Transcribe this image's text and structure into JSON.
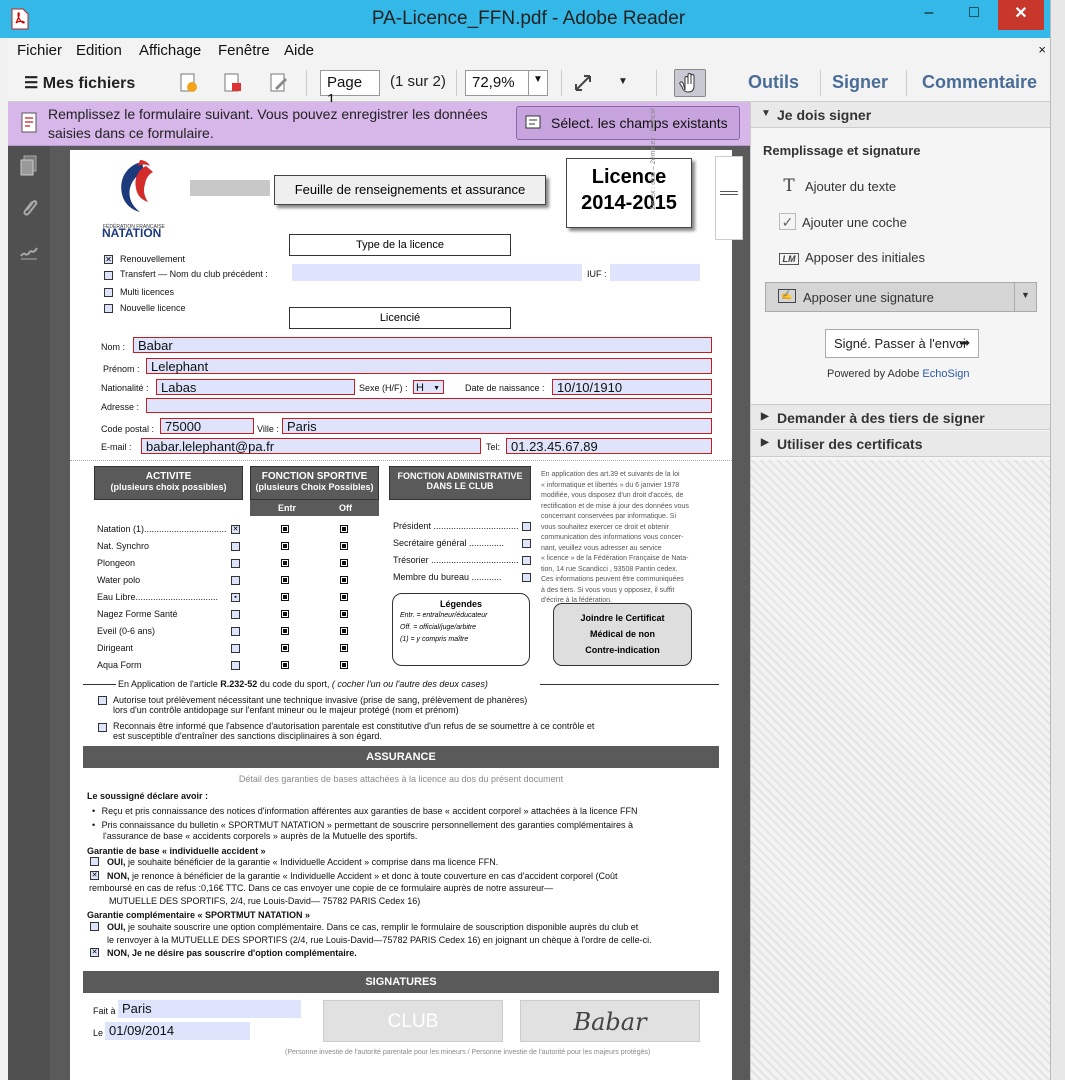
{
  "window": {
    "title": "PA-Licence_FFN.pdf - Adobe Reader",
    "minimize": "–",
    "maximize": "□",
    "close": "✕"
  },
  "menu": {
    "items": [
      "Fichier",
      "Edition",
      "Affichage",
      "Fenêtre",
      "Aide"
    ],
    "close": "×"
  },
  "toolbar": {
    "my_files": "Mes fichiers",
    "page_value": "Page 1",
    "page_of": "(1 sur 2)",
    "zoom": "72,9%",
    "tools": "Outils",
    "sign": "Signer",
    "comment": "Commentaire"
  },
  "notice": {
    "text": "Remplissez le formulaire suivant. Vous pouvez enregistrer les données saisies dans ce formulaire.",
    "button": "Sélect. les champs existants"
  },
  "panel": {
    "section1": "Je dois signer",
    "subheading": "Remplissage et signature",
    "add_text": "Ajouter du texte",
    "add_check": "Ajouter une coche",
    "add_initials": "Apposer des initiales",
    "add_signature": "Apposer une signature",
    "signed_send": "Signé. Passer à l'envoi",
    "powered": "Powered by Adobe",
    "echosign": "EchoSign",
    "section2": "Demander à des tiers de signer",
    "section3": "Utiliser des certificats"
  },
  "doc": {
    "logo_small": "FÉDÉRATION FRANÇAISE",
    "logo_name": "NATATION",
    "header_banner": "Feuille de renseignements et assurance",
    "licence_title": "Licence",
    "licence_year": "2014-2015",
    "side_note": "1er ex : club – 2ème ex : licencié",
    "type_section": "Type de la licence",
    "renouvellement": "Renouvellement",
    "transfert": "Transfert — Nom du club précédent :",
    "iuf": "IUF :",
    "multi": "Multi licences",
    "nouvelle": "Nouvelle licence",
    "licencie_section": "Licencié",
    "nom_label": "Nom :",
    "nom": "Babar",
    "prenom_label": "Prénom :",
    "prenom": "Lelephant",
    "nationalite_label": "Nationalité :",
    "nationalite": "Labas",
    "sexe_label": "Sexe (H/F) :",
    "sexe": "H",
    "naissance_label": "Date de naissance :",
    "naissance": "10/10/1910",
    "adresse_label": "Adresse :",
    "cp_label": "Code postal :",
    "cp": "75000",
    "ville_label": "Ville :",
    "ville": "Paris",
    "email_label": "E-mail :",
    "email": "babar.lelephant@pa.fr",
    "tel_label": "Tel:",
    "tel": "01.23.45.67.89",
    "activite_title": "ACTIVITE",
    "activite_sub": "(plusieurs choix possibles)",
    "fonction_title": "FONCTION SPORTIVE",
    "fonction_sub": "(plusieurs Choix Possibles)",
    "entr": "Entr",
    "off": "Off",
    "admin_title": "FONCTION ADMINISTRATIVE",
    "admin_sub": "DANS LE CLUB",
    "activites": [
      "Natation (1).................................",
      "Nat. Synchro",
      "Plongeon",
      "Water polo",
      "Eau Libre.................................",
      "Nagez Forme Santé",
      "Eveil (0-6 ans)",
      "Dirigeant",
      "Aqua Form"
    ],
    "admin_roles": [
      "Président ..................................",
      "Secrétaire général ..............",
      "Trésorier ...................................",
      "Membre du bureau ............"
    ],
    "cnil_1": "En application des art.39 et suivants de la loi",
    "cnil_2": "« informatique et libertés » du 6 janvier 1978",
    "cnil_3": "modifiée, vous disposez d'un droit d'accès, de",
    "cnil_4": "rectification et de mise à jour des données vous",
    "cnil_5": "concernant conservées par informatique. Si",
    "cnil_6": "vous souhaitez exercer ce droit et obtenir",
    "cnil_7": "communication des informations vous concer-",
    "cnil_8": "nant, veuillez vous adresser au service",
    "cnil_9": "« licence » de la  Fédération Française de Nata-",
    "cnil_10": "tion, 14 rue Scandicci , 93508 Pantin cedex.",
    "cnil_11": "Ces informations peuvent être communiquées",
    "cnil_12": "à des tiers. Si vous vous y opposez, il suffit",
    "cnil_13": "d'écrire à la fédération.",
    "legend_title": "Légendes",
    "legend_1": "Entr. = entraîneur/éducateur",
    "legend_2": "Off.  = official/juge/arbitre",
    "legend_3": "(1) = y compris maître",
    "cert_1": "Joindre le Certificat",
    "cert_2": "Médical de non",
    "cert_3": "Contre-indication",
    "article_1": "En Application de l'article ",
    "article_bold": "R.232-52",
    "article_2": " du code du sport, ",
    "article_3": "( cocher l'un ou l'autre des deux cases)",
    "auth_1": "Autorise tout prélèvement nécessitant une technique invasive (prise de sang, prélèvement de phanères)",
    "auth_2": "lors d'un contrôle antidopage sur l'enfant mineur ou le majeur protégé (nom et prénom)",
    "refus_1": "Reconnais être informé que l'absence d'autorisation parentale est constitutive d'un refus de se soumettre à ce contrôle et",
    "refus_2": "est susceptible d'entraîner des sanctions disciplinaires à son égard.",
    "assurance_band": "ASSURANCE",
    "assurance_sub": "Détail des garanties de bases attachées à la licence au dos du présent document",
    "declare": "Le soussigné déclare avoir :",
    "bullet_1": "Reçu et pris connaissance des notices d'information afférentes aux garanties de base « accident corporel » attachées à la licence FFN",
    "bullet_2a": "Pris connaissance du bulletin « SPORTMUT NATATION » permettant de souscrire personnellement des garanties complémentaires à",
    "bullet_2b": "l'assurance de base « accidents corporels » auprès de la Mutuelle des sportifs.",
    "garantie_base": "Garantie de base « individuelle accident »",
    "oui_1_b": "OUI,",
    "oui_1": " je souhaite bénéficier de la garantie « Individuelle Accident » comprise dans ma licence FFN.",
    "non_1_b": "NON,",
    "non_1": " je renonce à bénéficier de la garantie « Individuelle Accident » et donc à toute couverture en cas d'accident corporel (Coût",
    "non_1b": "remboursé en cas de refus :0,16€ TTC. Dans ce cas envoyer une copie de ce formulaire auprès de notre assureur—",
    "non_1c": "MUTUELLE DES SPORTIFS, 2/4, rue Louis-David— 75782 PARIS Cedex 16)",
    "garantie_comp": "Garantie complémentaire « SPORTMUT NATATION »",
    "oui_2_b": "OUI,",
    "oui_2": " je souhaite souscrire une option complémentaire. Dans ce cas, remplir le formulaire de souscription disponible auprès du club et",
    "oui_2b": "le renvoyer à la MUTUELLE DES SPORTIFS (2/4, rue Louis-David—75782 PARIS Cedex 16) en joignant un chèque à l'ordre de celle-ci.",
    "non_2_b": "NON,",
    "non_2": " Je ne désire pas souscrire d'option complémentaire.",
    "signatures_band": "SIGNATURES",
    "fait_label": "Fait à",
    "fait": "Paris",
    "le_label": "Le",
    "le": "01/09/2014",
    "club_sig": "CLUB",
    "user_sig": "Babar",
    "footer": "(Personne investie de l'autorité parentale pour les mineurs / Personne investie de l'autorité pour les majeurs protégés)"
  },
  "colors": {
    "titlebar": "#33b8e8",
    "close": "#c7372b",
    "notice": "#d7b7ea",
    "field": "#dde4fb",
    "field_border": "#c41e1e",
    "band": "#5a5a5a",
    "link": "#4a6d97"
  }
}
